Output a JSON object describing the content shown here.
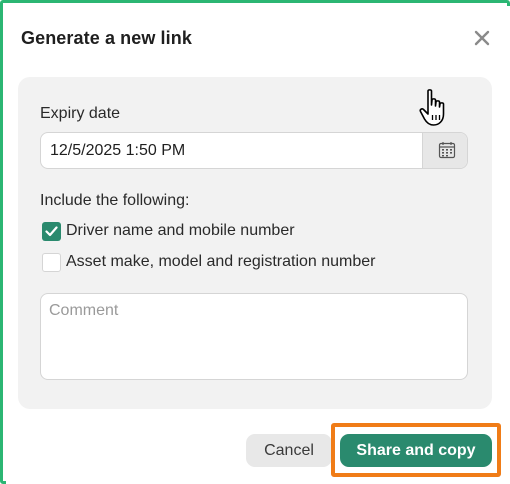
{
  "dialog": {
    "title": "Generate a new link",
    "close_icon": "close-icon"
  },
  "form": {
    "expiry_label": "Expiry date",
    "expiry_value": "12/5/2025 1:50 PM",
    "calendar_icon": "calendar-icon",
    "include_label": "Include the following:",
    "options": [
      {
        "label": "Driver name and mobile number",
        "checked": true
      },
      {
        "label": "Asset make, model and registration number",
        "checked": false
      }
    ],
    "comment_placeholder": "Comment",
    "comment_value": ""
  },
  "actions": {
    "cancel_label": "Cancel",
    "share_label": "Share and copy"
  },
  "colors": {
    "frame_border": "#2bb673",
    "primary": "#2a8a6e",
    "highlight": "#f07c17",
    "panel_bg": "#f2f2f2"
  }
}
